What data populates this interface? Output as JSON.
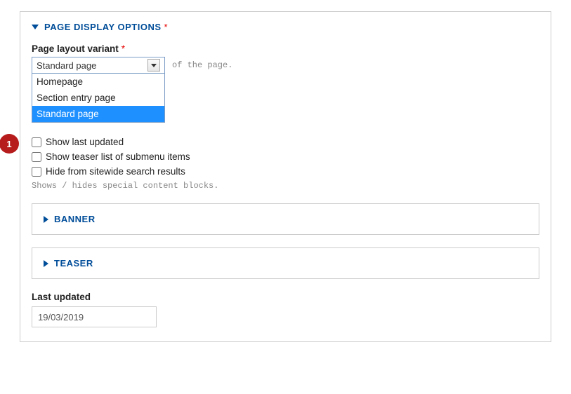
{
  "section": {
    "title": "PAGE DISPLAY OPTIONS"
  },
  "layout": {
    "label": "Page layout variant",
    "selected": "Standard page",
    "options": [
      "Homepage",
      "Section entry page",
      "Standard page"
    ],
    "helper": "of the page."
  },
  "checkboxes": {
    "show_last_updated": "Show last updated",
    "show_teaser_list": "Show teaser list of submenu items",
    "hide_from_search": "Hide from sitewide search results",
    "helper": "Shows / hides special content blocks."
  },
  "subpanels": {
    "banner": "BANNER",
    "teaser": "TEASER"
  },
  "last_updated": {
    "label": "Last updated",
    "value": "19/03/2019"
  },
  "step": "1"
}
